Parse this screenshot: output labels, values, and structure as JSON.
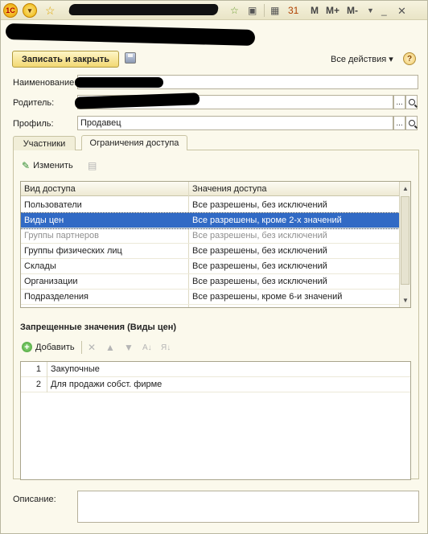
{
  "titlebar": {
    "toolbar_texts": [
      "M",
      "M+",
      "M-"
    ],
    "icons": [
      "logo-icon",
      "main-menu-icon",
      "star-icon",
      "favorites-icon",
      "history-icon",
      "calculator-icon",
      "calendar-icon",
      "dropdown-icon",
      "close-icon"
    ]
  },
  "form": {
    "save_close_label": "Записать и закрыть",
    "all_actions_label": "Все действия ▾",
    "help_label": "?"
  },
  "fields": {
    "name_label": "Наименование:",
    "parent_label": "Родитель:",
    "profile_label": "Профиль:",
    "profile_value": "Продавец",
    "dots": "..."
  },
  "tabs": [
    {
      "label": "Участники",
      "active": false
    },
    {
      "label": "Ограничения доступа",
      "active": true
    }
  ],
  "access_toolbar": {
    "edit_label": "Изменить"
  },
  "access_grid": {
    "columns": [
      "Вид доступа",
      "Значения доступа"
    ],
    "rows": [
      {
        "kind": "Пользователи",
        "value": "Все разрешены, без исключений",
        "state": "normal"
      },
      {
        "kind": "Виды цен",
        "value": "Все разрешены, кроме 2-х значений",
        "state": "selected"
      },
      {
        "kind": "Группы партнеров",
        "value": "Все разрешены, без исключений",
        "state": "dim"
      },
      {
        "kind": "Группы физических лиц",
        "value": "Все разрешены, без исключений",
        "state": "normal"
      },
      {
        "kind": "Склады",
        "value": "Все разрешены, без исключений",
        "state": "normal"
      },
      {
        "kind": "Организации",
        "value": "Все разрешены, без исключений",
        "state": "normal"
      },
      {
        "kind": "Подразделения",
        "value": "Все разрешены, кроме 6-и значений",
        "state": "normal"
      }
    ]
  },
  "forbidden": {
    "title": "Запрещенные значения (Виды цен)",
    "add_label": "Добавить",
    "rows": [
      {
        "num": "1",
        "text": "Закупочные"
      },
      {
        "num": "2",
        "text": "Для продажи собст. фирме"
      }
    ]
  },
  "description": {
    "label": "Описание:"
  }
}
